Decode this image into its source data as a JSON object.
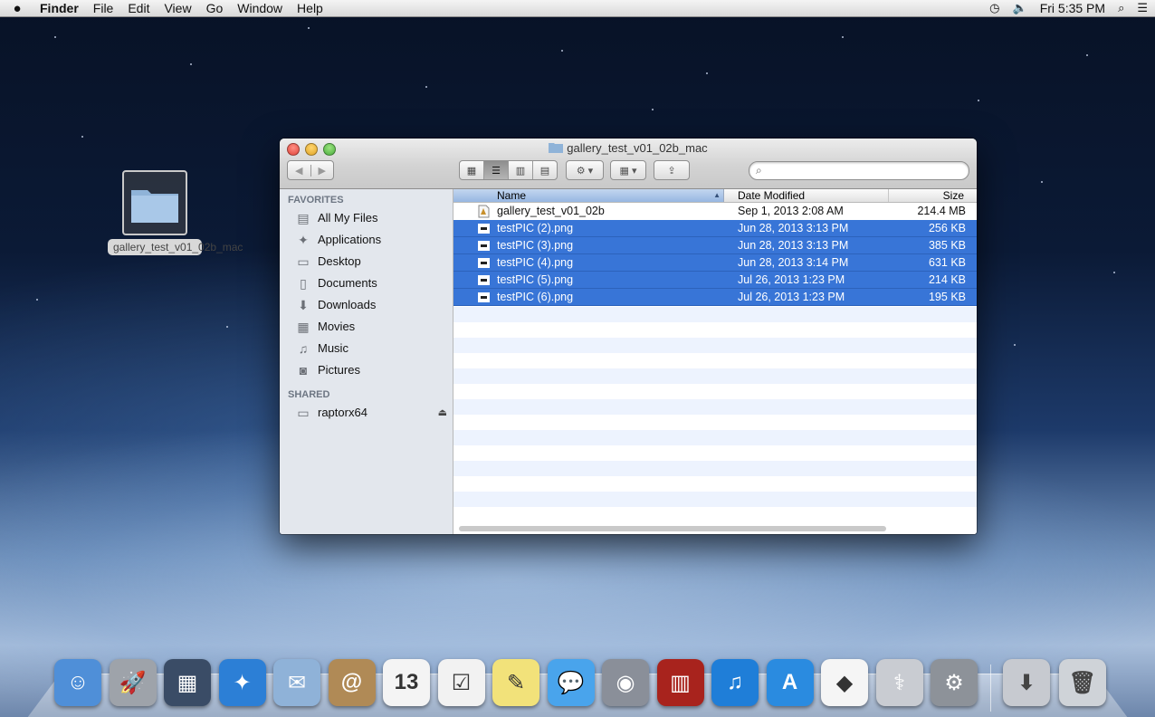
{
  "menubar": {
    "app_name": "Finder",
    "menus": [
      "File",
      "Edit",
      "View",
      "Go",
      "Window",
      "Help"
    ],
    "clock": "Fri 5:35 PM"
  },
  "desktop": {
    "folder_label": "gallery_test_v01_02b_mac"
  },
  "window": {
    "title": "gallery_test_v01_02b_mac",
    "search_placeholder": ""
  },
  "sidebar": {
    "favorites_header": "FAVORITES",
    "favorites": [
      {
        "label": "All My Files",
        "icon": "all-files-icon"
      },
      {
        "label": "Applications",
        "icon": "applications-icon"
      },
      {
        "label": "Desktop",
        "icon": "desktop-icon"
      },
      {
        "label": "Documents",
        "icon": "documents-icon"
      },
      {
        "label": "Downloads",
        "icon": "downloads-icon"
      },
      {
        "label": "Movies",
        "icon": "movies-icon"
      },
      {
        "label": "Music",
        "icon": "music-icon"
      },
      {
        "label": "Pictures",
        "icon": "pictures-icon"
      }
    ],
    "shared_header": "SHARED",
    "shared": [
      {
        "label": "raptorx64",
        "icon": "computer-icon"
      }
    ]
  },
  "columns": {
    "name": "Name",
    "date": "Date Modified",
    "size": "Size"
  },
  "files": [
    {
      "name": "gallery_test_v01_02b",
      "date": "Sep 1, 2013 2:08 AM",
      "size": "214.4 MB",
      "selected": false,
      "icon": "app-document-icon"
    },
    {
      "name": "testPIC (2).png",
      "date": "Jun 28, 2013 3:13 PM",
      "size": "256 KB",
      "selected": true,
      "icon": "png-file-icon"
    },
    {
      "name": "testPIC (3).png",
      "date": "Jun 28, 2013 3:13 PM",
      "size": "385 KB",
      "selected": true,
      "icon": "png-file-icon"
    },
    {
      "name": "testPIC (4).png",
      "date": "Jun 28, 2013 3:14 PM",
      "size": "631 KB",
      "selected": true,
      "icon": "png-file-icon"
    },
    {
      "name": "testPIC (5).png",
      "date": "Jul 26, 2013 1:23 PM",
      "size": "214 KB",
      "selected": true,
      "icon": "png-file-icon"
    },
    {
      "name": "testPIC (6).png",
      "date": "Jul 26, 2013 1:23 PM",
      "size": "195 KB",
      "selected": true,
      "icon": "png-file-icon"
    }
  ],
  "dock": {
    "apps": [
      {
        "name": "finder-icon",
        "color": "#4f8fd8",
        "glyph": "☺"
      },
      {
        "name": "launchpad-icon",
        "color": "#9ea3aa",
        "glyph": "🚀"
      },
      {
        "name": "mission-control-icon",
        "color": "#3a4c66",
        "glyph": "▦"
      },
      {
        "name": "safari-icon",
        "color": "#2c7fd6",
        "glyph": "✦"
      },
      {
        "name": "mail-icon",
        "color": "#8fb2d8",
        "glyph": "✉"
      },
      {
        "name": "contacts-icon",
        "color": "#b08a56",
        "glyph": "@"
      },
      {
        "name": "calendar-icon",
        "color": "#f4f4f4",
        "glyph": "13"
      },
      {
        "name": "reminders-icon",
        "color": "#f2f2f2",
        "glyph": "☑"
      },
      {
        "name": "notes-icon",
        "color": "#f2e27a",
        "glyph": "✎"
      },
      {
        "name": "messages-icon",
        "color": "#49a4ec",
        "glyph": "💬"
      },
      {
        "name": "facetime-icon",
        "color": "#8a8f99",
        "glyph": "◉"
      },
      {
        "name": "photo-booth-icon",
        "color": "#a8231d",
        "glyph": "▥"
      },
      {
        "name": "itunes-icon",
        "color": "#1f7ed8",
        "glyph": "♫"
      },
      {
        "name": "app-store-icon",
        "color": "#2a8be0",
        "glyph": "A"
      },
      {
        "name": "unity-icon",
        "color": "#f5f5f5",
        "glyph": "◆"
      },
      {
        "name": "disk-utility-icon",
        "color": "#c9ccd2",
        "glyph": "⚕"
      },
      {
        "name": "system-preferences-icon",
        "color": "#8d9299",
        "glyph": "⚙"
      }
    ],
    "right": [
      {
        "name": "installer-icon",
        "color": "#c7cad0",
        "glyph": "⬇"
      },
      {
        "name": "trash-icon",
        "color": "#cfd3d8",
        "glyph": "🗑"
      }
    ]
  }
}
